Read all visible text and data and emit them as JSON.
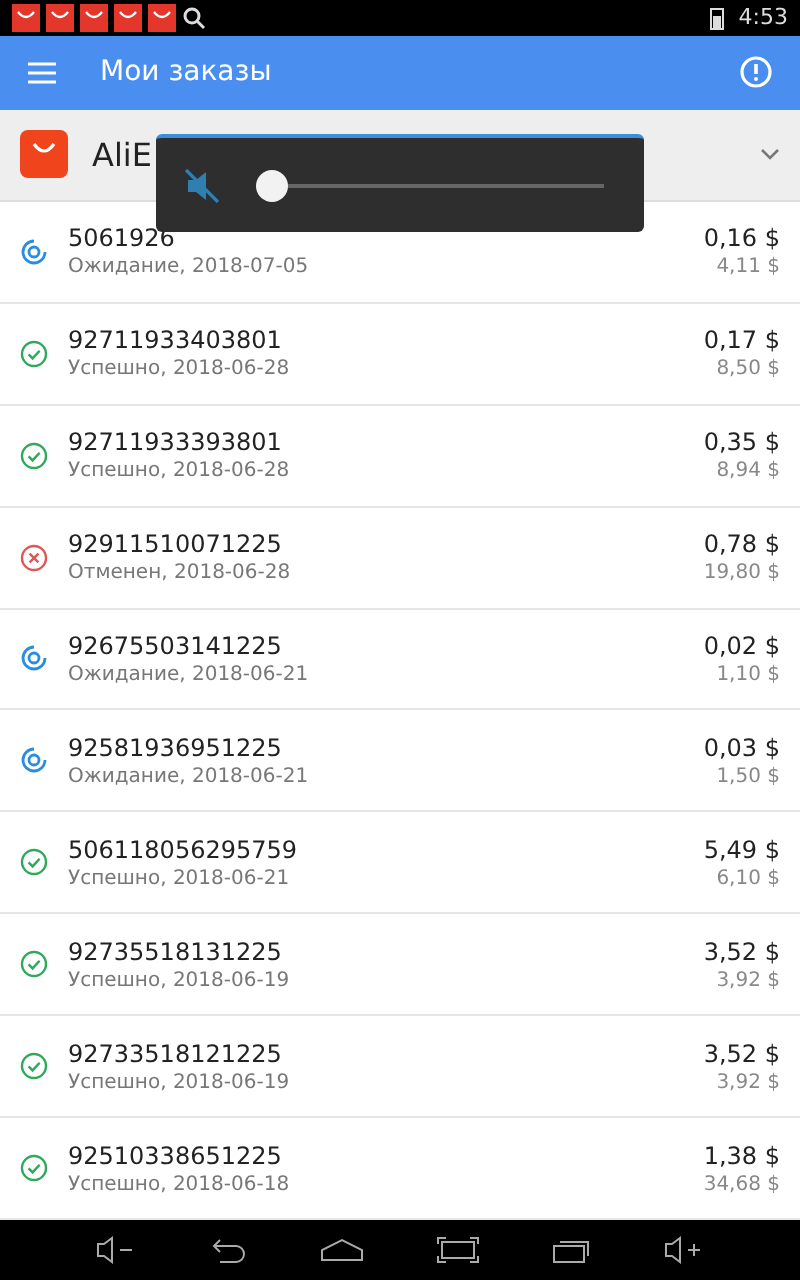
{
  "status_bar": {
    "time": "4:53"
  },
  "header": {
    "title": "Мои заказы"
  },
  "store": {
    "name": "AliE"
  },
  "volume": {
    "muted": true,
    "level": 0
  },
  "orders": [
    {
      "number": "5061926",
      "kind": "pending",
      "info": "Ожидание, 2018-07-05",
      "price": "0,16 $",
      "total": "4,11 $"
    },
    {
      "number": "92711933403801",
      "kind": "success",
      "info": "Успешно, 2018-06-28",
      "price": "0,17 $",
      "total": "8,50 $"
    },
    {
      "number": "92711933393801",
      "kind": "success",
      "info": "Успешно, 2018-06-28",
      "price": "0,35 $",
      "total": "8,94 $"
    },
    {
      "number": "92911510071225",
      "kind": "cancelled",
      "info": "Отменен, 2018-06-28",
      "price": "0,78 $",
      "total": "19,80 $"
    },
    {
      "number": "92675503141225",
      "kind": "pending",
      "info": "Ожидание, 2018-06-21",
      "price": "0,02 $",
      "total": "1,10 $"
    },
    {
      "number": "92581936951225",
      "kind": "pending",
      "info": "Ожидание, 2018-06-21",
      "price": "0,03 $",
      "total": "1,50 $"
    },
    {
      "number": "506118056295759",
      "kind": "success",
      "info": "Успешно, 2018-06-21",
      "price": "5,49 $",
      "total": "6,10 $"
    },
    {
      "number": "92735518131225",
      "kind": "success",
      "info": "Успешно, 2018-06-19",
      "price": "3,52 $",
      "total": "3,92 $"
    },
    {
      "number": "92733518121225",
      "kind": "success",
      "info": "Успешно, 2018-06-19",
      "price": "3,52 $",
      "total": "3,92 $"
    },
    {
      "number": "92510338651225",
      "kind": "success",
      "info": "Успешно, 2018-06-18",
      "price": "1,38 $",
      "total": "34,68 $"
    }
  ]
}
